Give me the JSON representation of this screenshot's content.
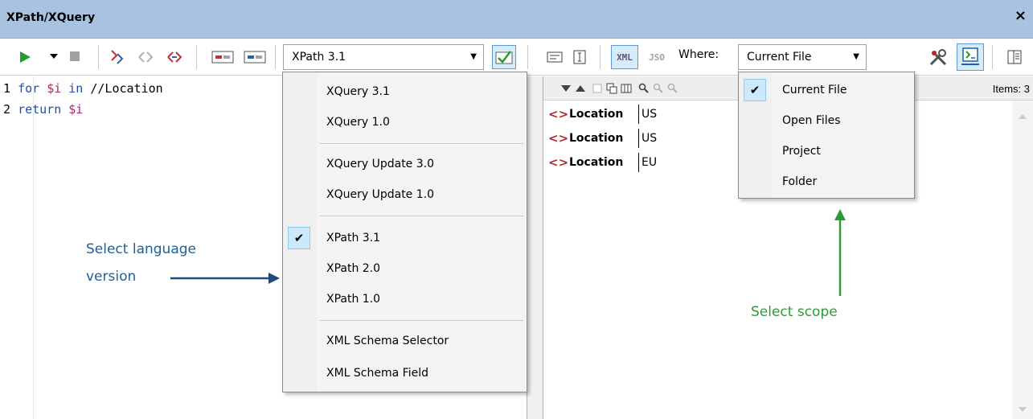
{
  "window": {
    "title": "XPath/XQuery",
    "close_glyph": "×"
  },
  "toolbar": {
    "language_combo_value": "XPath 3.1",
    "where_label": "Where:",
    "scope_combo_value": "Current File",
    "xml_label": "XML",
    "json_label": "JSO"
  },
  "editor": {
    "lines": [
      {
        "num": "1",
        "kw1": "for",
        "var": "$i",
        "kw2": "in",
        "rest": "//Location"
      },
      {
        "num": "2",
        "kw1": "return",
        "var": "$i"
      }
    ]
  },
  "results": {
    "items_count": "Items: 3",
    "rows": [
      {
        "name": "Location",
        "value": "US"
      },
      {
        "name": "Location",
        "value": "US"
      },
      {
        "name": "Location",
        "value": "EU"
      }
    ]
  },
  "language_menu": {
    "items": [
      "XQuery 3.1",
      "XQuery 1.0",
      "XQuery Update 3.0",
      "XQuery Update 1.0",
      "XPath 3.1",
      "XPath 2.0",
      "XPath 1.0",
      "XML Schema Selector",
      "XML Schema Field"
    ],
    "checked": "XPath 3.1"
  },
  "scope_menu": {
    "items": [
      "Current File",
      "Open Files",
      "Project",
      "Folder"
    ],
    "checked": "Current File"
  },
  "annotations": {
    "language": {
      "line1": "Select language",
      "line2": "version"
    },
    "scope": "Select scope"
  },
  "colors": {
    "titlebar": "#a8c3e0",
    "annotation_blue": "#1f5f99",
    "annotation_green": "#2e9a3a",
    "checked_item_bg": "#cce8fb",
    "play_green": "#1f9e2c",
    "tag_red": "#b5282a"
  }
}
